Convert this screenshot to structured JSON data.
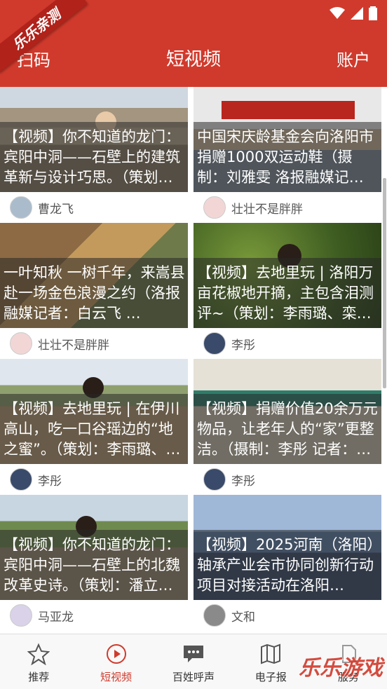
{
  "ribbon": "乐乐亲测",
  "header": {
    "left": "扫码",
    "title": "短视频",
    "right": "账户"
  },
  "cards": [
    {
      "caption": "【视频】你不知道的龙门：宾阳中洞——石壁上的建筑革新与设计巧思。（策划：潘立、…",
      "author": "曹龙飞"
    },
    {
      "caption": "中国宋庆龄基金会向洛阳市捐赠1000双运动鞋（摄制：刘雅雯 洛报融媒记者：…",
      "author": "壮壮不是胖胖"
    },
    {
      "caption": "一叶知秋 一树千年，来嵩县赴一场金色浪漫之约（洛报融媒记者：白云飞 …",
      "author": "壮壮不是胖胖"
    },
    {
      "caption": "【视频】去地里玩 | 洛阳万亩花椒地开摘，主包含泪测评~（策划：李雨璐、栾…",
      "author": "李彤"
    },
    {
      "caption": "【视频】去地里玩 | 在伊川高山，吃一口谷瑶边的“地之蜜”。（策划：李雨璐、…",
      "author": "李彤"
    },
    {
      "caption": "【视频】捐赠价值20余万元物品，让老年人的“家”更整洁。（摄制：李彤 记者：…",
      "author": "李彤"
    },
    {
      "caption": "【视频】你不知道的龙门：宾阳中洞——石壁上的北魏改革史诗。（策划：潘立…",
      "author": "马亚龙"
    },
    {
      "caption": "【视频】2025河南（洛阳）轴承产业会市协同创新行动项目对接活动在洛阳…",
      "author": "文和"
    }
  ],
  "tabs": [
    {
      "label": "推荐",
      "icon": "star-icon"
    },
    {
      "label": "短视频",
      "icon": "play-circle-icon"
    },
    {
      "label": "百姓呼声",
      "icon": "chat-bubble-icon"
    },
    {
      "label": "电子报",
      "icon": "map-book-icon"
    },
    {
      "label": "服务",
      "icon": "service-icon"
    }
  ],
  "watermark": "乐乐游戏",
  "colors": {
    "brand": "#d03a2c",
    "active_tab": "#d03a2c"
  }
}
